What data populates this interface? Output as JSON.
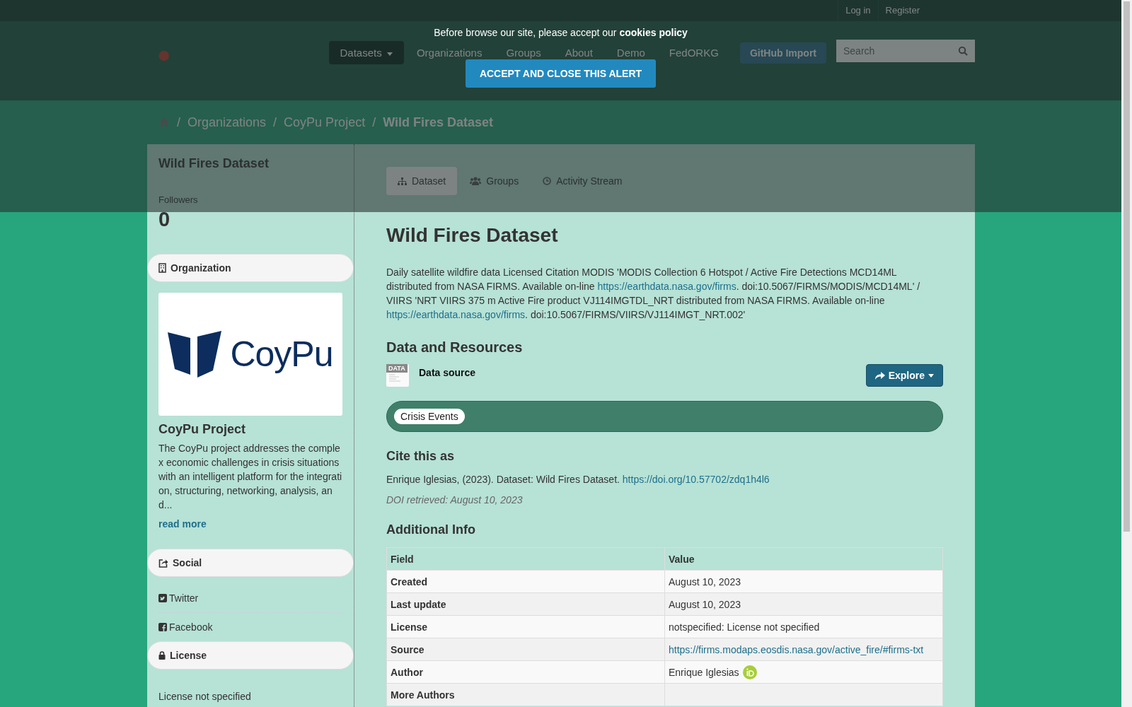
{
  "top_links": [
    "Log in",
    "Register"
  ],
  "nav": [
    {
      "label": "Datasets",
      "selected": true,
      "kind": "dropdown"
    },
    {
      "label": "Organizations",
      "selected": false,
      "kind": "link"
    },
    {
      "label": "Groups",
      "selected": false,
      "kind": "link"
    },
    {
      "label": "About",
      "selected": false,
      "kind": "link"
    },
    {
      "label": "Demo",
      "selected": false,
      "kind": "link"
    },
    {
      "label": "FedORKG",
      "selected": false,
      "kind": "link"
    },
    {
      "label": "GitHub Import",
      "selected": false,
      "kind": "button"
    }
  ],
  "search": {
    "placeholder": "Search"
  },
  "cookie_alert": {
    "message": "Before browse our site, please accept our **cookies policy**",
    "button": "ACCEPT AND CLOSE THIS ALERT"
  },
  "breadcrumb": [
    {
      "separator": "/",
      "label": "Organizations",
      "current": false
    },
    {
      "separator": "/",
      "label": "CoyPu Project",
      "current": false
    },
    {
      "separator": "/",
      "label": "Wild Fires Dataset",
      "current": true
    }
  ],
  "sidebar": {
    "title": "Wild Fires Dataset",
    "followers_label": "Followers",
    "followers": "0",
    "organization": {
      "heading": "Organization",
      "logo_text": "CoyPu",
      "name": "CoyPu Project",
      "description": "The CoyPu project addresses the comple x economic challenges in crisis situations with an intelligent platform for the integrati on, structuring, networking, analysis, an d...",
      "read_more": "read more"
    },
    "social": {
      "heading": "Social",
      "links": [
        {
          "label": "Twitter",
          "kind": "twitter"
        },
        {
          "label": "Facebook",
          "kind": "facebook"
        }
      ]
    },
    "license": {
      "heading": "License",
      "text": "License not specified"
    }
  },
  "tabs": [
    {
      "label": "Dataset",
      "selected": true,
      "kind": "sitemap"
    },
    {
      "label": "Groups",
      "selected": false,
      "kind": "users"
    },
    {
      "label": "Activity Stream",
      "selected": false,
      "kind": "clock"
    }
  ],
  "dataset": {
    "title": "Wild Fires Dataset",
    "description": [
      {
        "kind": "text",
        "text": "Daily satellite wildfire data Licensed Citation MODIS 'MODIS Collection 6 Hotspot / Active Fire Detections MCD14ML distributed from NASA FIRMS. Available on-line "
      },
      {
        "kind": "link",
        "text": "https://earthdata.nasa.gov/firms"
      },
      {
        "kind": "text",
        "text": ". doi:10.5067/FIRMS/MODIS/MCD14ML' / VIIRS 'NRT VIIRS 375 m Active Fire product VJ114IMGTDL_NRT distributed from NASA FIRMS. Available on-line "
      },
      {
        "kind": "link",
        "text": "https://earthdata.nasa.gov/firms"
      },
      {
        "kind": "text",
        "text": ". doi:10.5067/FIRMS/VIIRS/VJ114IMGT_NRT.002'"
      }
    ],
    "resources_heading": "Data and Resources",
    "resources": [
      {
        "icon_label": "DATA",
        "name": "Data source",
        "button": "Explore"
      }
    ],
    "tags": [
      "Crisis Events"
    ],
    "cite_heading": "Cite this as",
    "citation": "Enrique Iglesias, (2023). Dataset: Wild Fires Dataset. ",
    "citation_link": "https://doi.org/10.57702/zdq1h4l6",
    "doi_retrieved": "DOI retrieved: August 10, 2023",
    "info_heading": "Additional Info",
    "columns": [
      "Field",
      "Value"
    ],
    "rows": [
      {
        "field": "Created",
        "value": "August 10, 2023",
        "kind": "text"
      },
      {
        "field": "Last update",
        "value": "August 10, 2023",
        "kind": "text"
      },
      {
        "field": "License",
        "value": "notspecified: License not specified",
        "kind": "text"
      },
      {
        "field": "Source",
        "value": "https://firms.modaps.eosdis.nasa.gov/active_fire/#firms-txt",
        "kind": "link"
      },
      {
        "field": "Author",
        "value": "Enrique Iglesias",
        "kind": "orcid"
      },
      {
        "field": "More Authors",
        "kind": "text"
      }
    ]
  }
}
